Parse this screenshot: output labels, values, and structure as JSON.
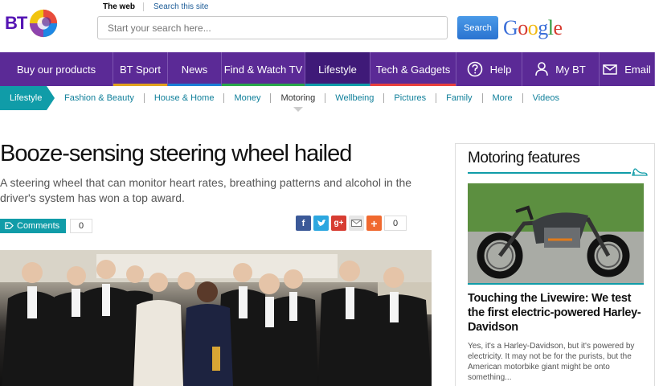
{
  "header": {
    "logo_text": "BT",
    "search_tab_web": "The web",
    "search_tab_site": "Search this site",
    "search_placeholder": "Start your search here...",
    "search_button": "Search",
    "google_letters": [
      "G",
      "o",
      "o",
      "g",
      "l",
      "e"
    ],
    "google_colors": [
      "#3b6fd8",
      "#d63a2f",
      "#f2b90f",
      "#3b6fd8",
      "#2e9a3e",
      "#d63a2f"
    ]
  },
  "nav": {
    "items": [
      {
        "label": "Buy our products",
        "bar": "#5b2a96"
      },
      {
        "label": "BT Sport",
        "bar": "#e0a21d"
      },
      {
        "label": "News",
        "bar": "#1b7ed6"
      },
      {
        "label": "Find & Watch TV",
        "bar": "#2aa84a"
      },
      {
        "label": "Lifestyle",
        "bar": "#109ca8"
      },
      {
        "label": "Tech & Gadgets",
        "bar": "#e8403d"
      },
      {
        "label": "Help",
        "bar": "#5b2a96",
        "icon": "help-icon"
      },
      {
        "label": "My BT",
        "bar": "#5b2a96",
        "icon": "user-icon"
      },
      {
        "label": "Email",
        "bar": "#5b2a96",
        "icon": "envelope-icon"
      }
    ]
  },
  "subnav": {
    "section": "Lifestyle",
    "items": [
      "Fashion & Beauty",
      "House & Home",
      "Money",
      "Motoring",
      "Wellbeing",
      "Pictures",
      "Family",
      "More",
      "Videos"
    ],
    "active": "Motoring"
  },
  "article": {
    "headline": "Booze-sensing steering wheel hailed",
    "standfirst": "A steering wheel that can monitor heart rates, breathing patterns and alcohol in the driver's system has won a top award.",
    "comments_label": "Comments",
    "comments_count": "0",
    "share_count": "0",
    "share_icons": [
      "facebook-icon",
      "twitter-icon",
      "googleplus-icon",
      "email-share-icon",
      "more-share-icon"
    ]
  },
  "sidebar": {
    "title": "Motoring features",
    "story_headline": "Touching the Livewire: We test the first electric-powered Harley-Davidson",
    "story_text": "Yes, it's a Harley-Davidson, but it's powered by electricity. It may not be for the purists, but the American motorbike giant might be onto something..."
  },
  "colors": {
    "bt_purple": "#5b2a96",
    "teal": "#109ca8",
    "link": "#0f7f9a"
  }
}
